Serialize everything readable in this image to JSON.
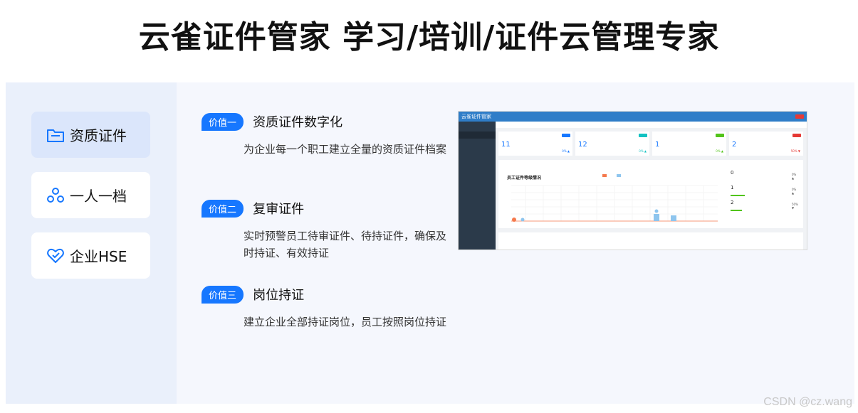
{
  "headline": "云雀证件管家 学习/培训/证件云管理专家",
  "sidebar": {
    "items": [
      {
        "label": "资质证件",
        "icon": "folder-icon"
      },
      {
        "label": "一人一档",
        "icon": "people-icon"
      },
      {
        "label": "企业HSE",
        "icon": "heart-check-icon"
      }
    ]
  },
  "values": [
    {
      "badge": "价值一",
      "title": "资质证件数字化",
      "desc": "为企业每一个职工建立全量的资质证件档案"
    },
    {
      "badge": "价值二",
      "title": "复审证件",
      "desc": "实时预警员工待审证件、待持证件，确保及时持证、有效持证"
    },
    {
      "badge": "价值三",
      "title": "岗位持证",
      "desc": "建立企业全部持证岗位，员工按照岗位持证"
    }
  ],
  "dashboard": {
    "brand": "云雀证件管家",
    "stats": [
      {
        "value": "11",
        "pct": "0% ▲"
      },
      {
        "value": "12",
        "pct": "0% ▲"
      },
      {
        "value": "1",
        "pct": "0% ▲"
      },
      {
        "value": "2",
        "pct": "50% ▼"
      }
    ],
    "chart_title": "员工证件等级情况",
    "right_values": [
      {
        "value": "0",
        "pct": "0% ▲"
      },
      {
        "value": "1",
        "pct": "0% ▲"
      },
      {
        "value": "2",
        "pct": "50% ▼"
      }
    ]
  },
  "watermark": "CSDN @cz.wang",
  "colors": {
    "accent": "#1677ff",
    "sidebar_bg": "#eaf0fb",
    "panel_bg": "#f5f7fd",
    "active_item": "#dbe6fb"
  }
}
